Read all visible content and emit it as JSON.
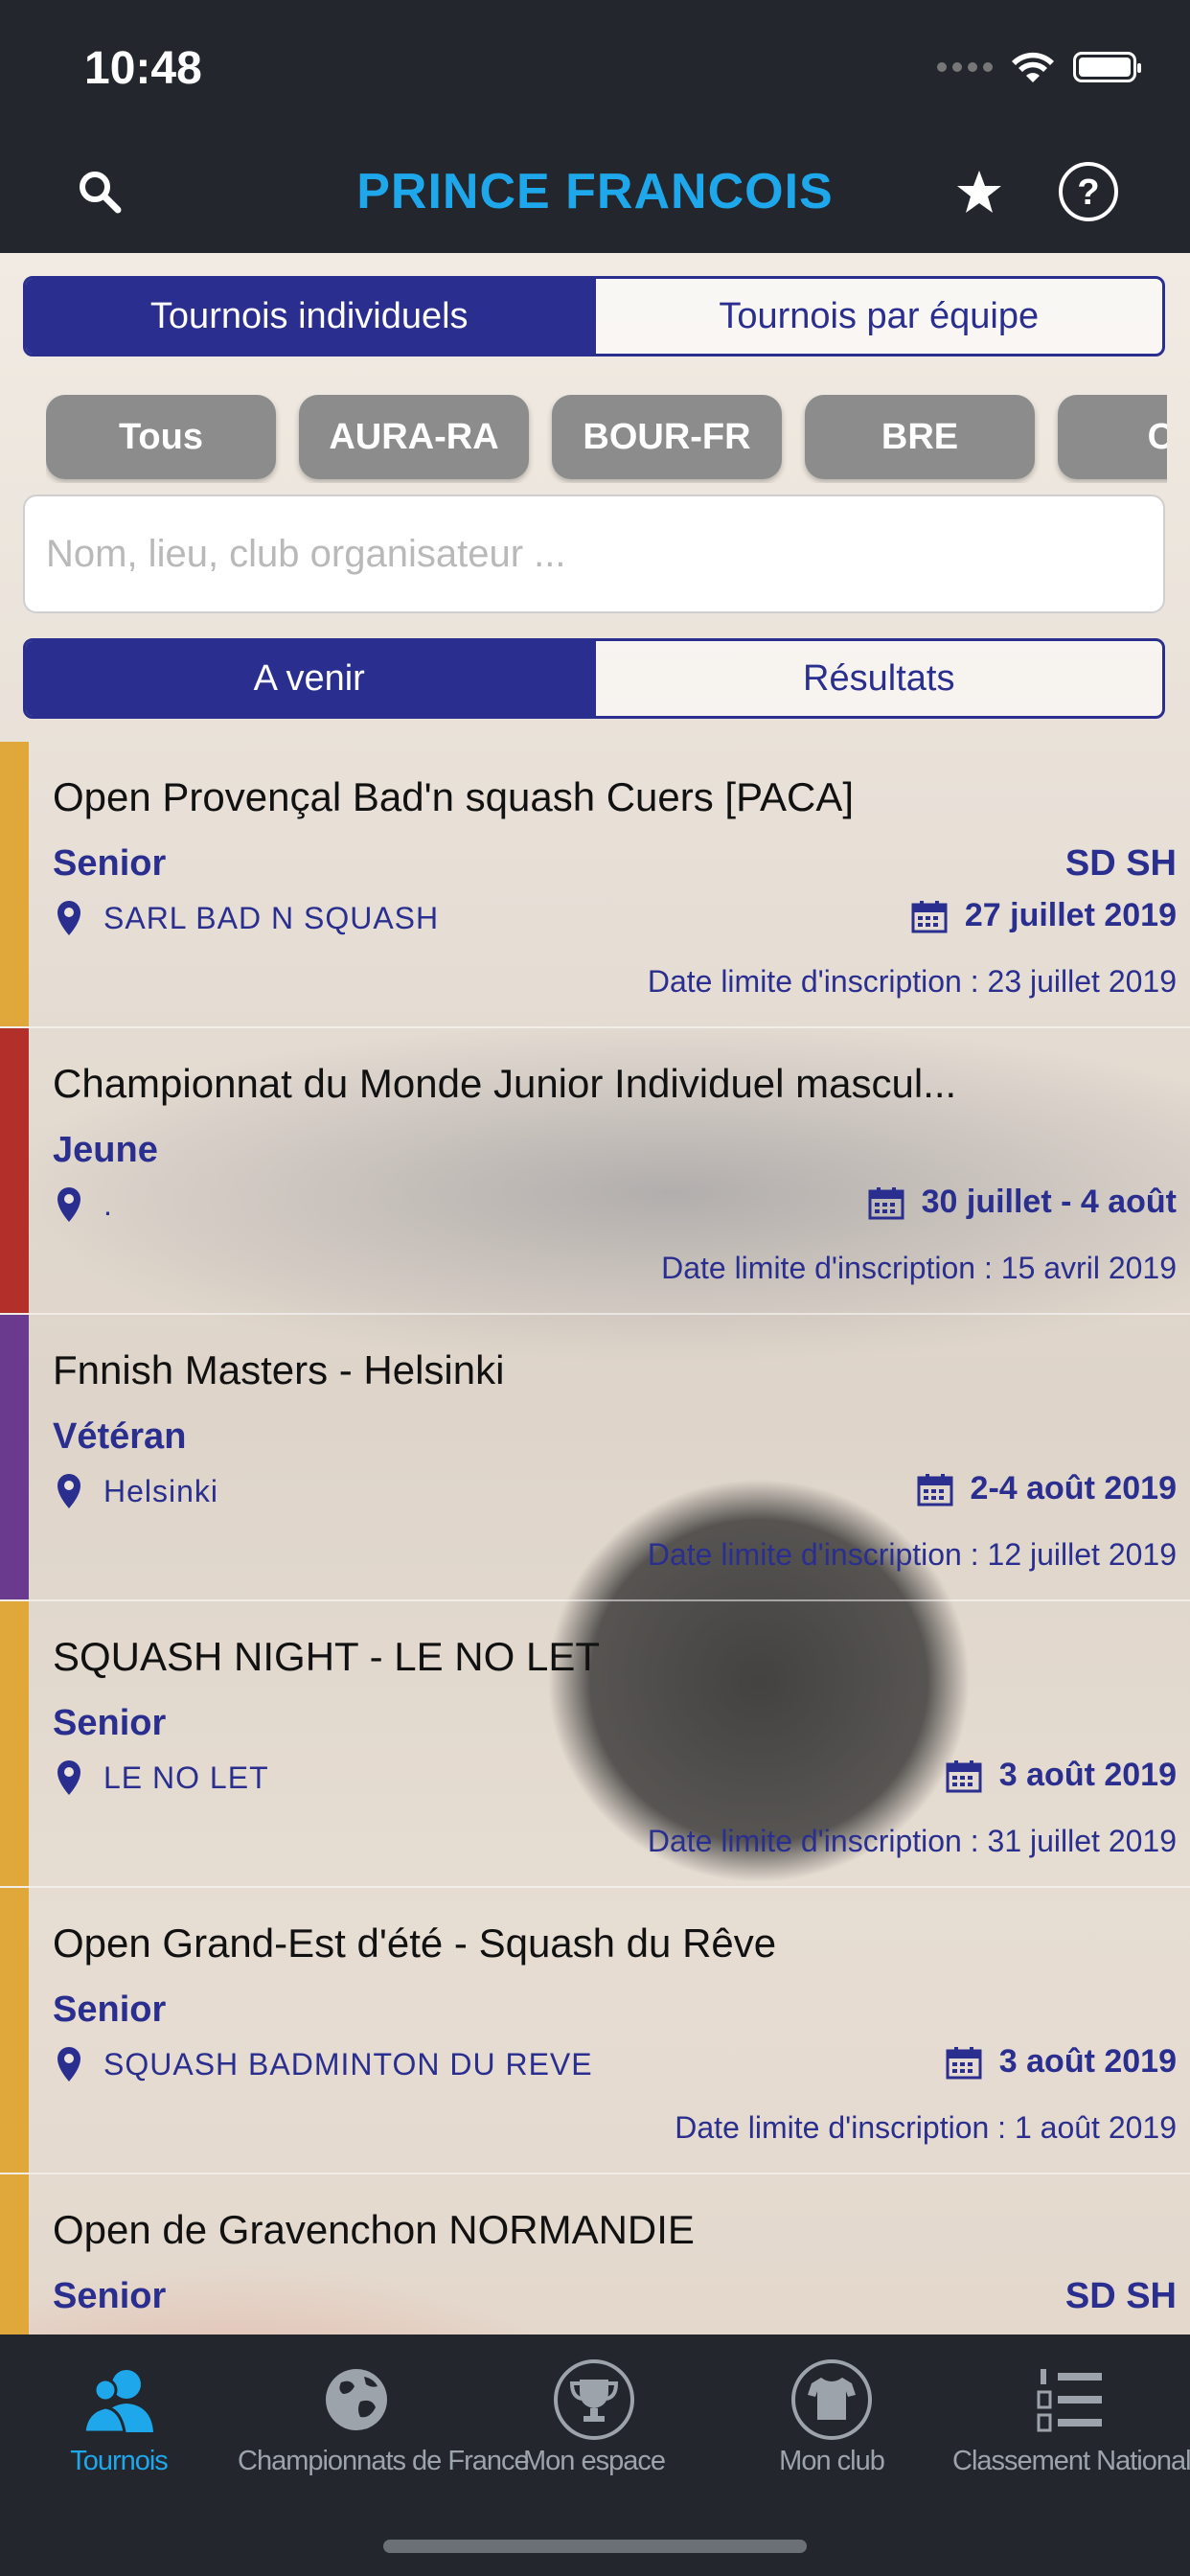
{
  "status_bar": {
    "time": "10:48"
  },
  "nav": {
    "title": "PRINCE FRANCOIS"
  },
  "tournament_type_tabs": [
    {
      "label": "Tournois individuels",
      "active": true
    },
    {
      "label": "Tournois par équipe",
      "active": false
    }
  ],
  "region_filters": [
    "Tous",
    "AURA-RA",
    "BOUR-FR",
    "BRE",
    "CE"
  ],
  "search": {
    "placeholder": "Nom, lieu, club organisateur ...",
    "value": ""
  },
  "period_tabs": [
    {
      "label": "A venir",
      "active": true
    },
    {
      "label": "Résultats",
      "active": false
    }
  ],
  "tournaments": [
    {
      "title": "Open Provençal Bad'n squash Cuers [PACA]",
      "category": "Senior",
      "tags": "SD SH",
      "place": "SARL BAD N SQUASH",
      "date": "27 juillet 2019",
      "deadline": "Date limite d'inscription : 23 juillet 2019",
      "stripe_color": "#e0a83a"
    },
    {
      "title": "Championnat du Monde Junior Individuel mascul...",
      "category": "Jeune",
      "tags": "",
      "place": ".",
      "date": "30 juillet - 4 août",
      "deadline": "Date limite d'inscription : 15 avril 2019",
      "stripe_color": "#b22f2a"
    },
    {
      "title": "Fnnish Masters - Helsinki",
      "category": "Vétéran",
      "tags": "",
      "place": "Helsinki",
      "date": "2-4 août 2019",
      "deadline": "Date limite d'inscription : 12 juillet 2019",
      "stripe_color": "#6a3a8e"
    },
    {
      "title": "SQUASH NIGHT - LE NO LET",
      "category": "Senior",
      "tags": "",
      "place": "LE NO LET",
      "date": "3 août 2019",
      "deadline": "Date limite d'inscription : 31 juillet 2019",
      "stripe_color": "#e0a83a"
    },
    {
      "title": "Open Grand-Est d'été - Squash du Rêve",
      "category": "Senior",
      "tags": "",
      "place": "SQUASH BADMINTON DU REVE",
      "date": "3 août 2019",
      "deadline": "Date limite d'inscription : 1 août 2019",
      "stripe_color": "#e0a83a"
    },
    {
      "title": "Open de Gravenchon NORMANDIE",
      "category": "Senior",
      "tags": "SD SH",
      "place": "",
      "date": "",
      "deadline": "",
      "stripe_color": "#e0a83a"
    }
  ],
  "tab_bar": [
    {
      "label": "Tournois",
      "icon": "user-group-icon",
      "active": true
    },
    {
      "label": "Championnats de France",
      "icon": "globe-icon",
      "active": false
    },
    {
      "label": "Mon espace",
      "icon": "trophy-icon",
      "active": false
    },
    {
      "label": "Mon club",
      "icon": "shirt-icon",
      "active": false
    },
    {
      "label": "Classement National",
      "icon": "ranking-list-icon",
      "active": false
    }
  ],
  "colors": {
    "accent": "#1ea7ea",
    "primary": "#2a2f8f",
    "chip": "#8c8c8c",
    "bar": "#23272d"
  }
}
